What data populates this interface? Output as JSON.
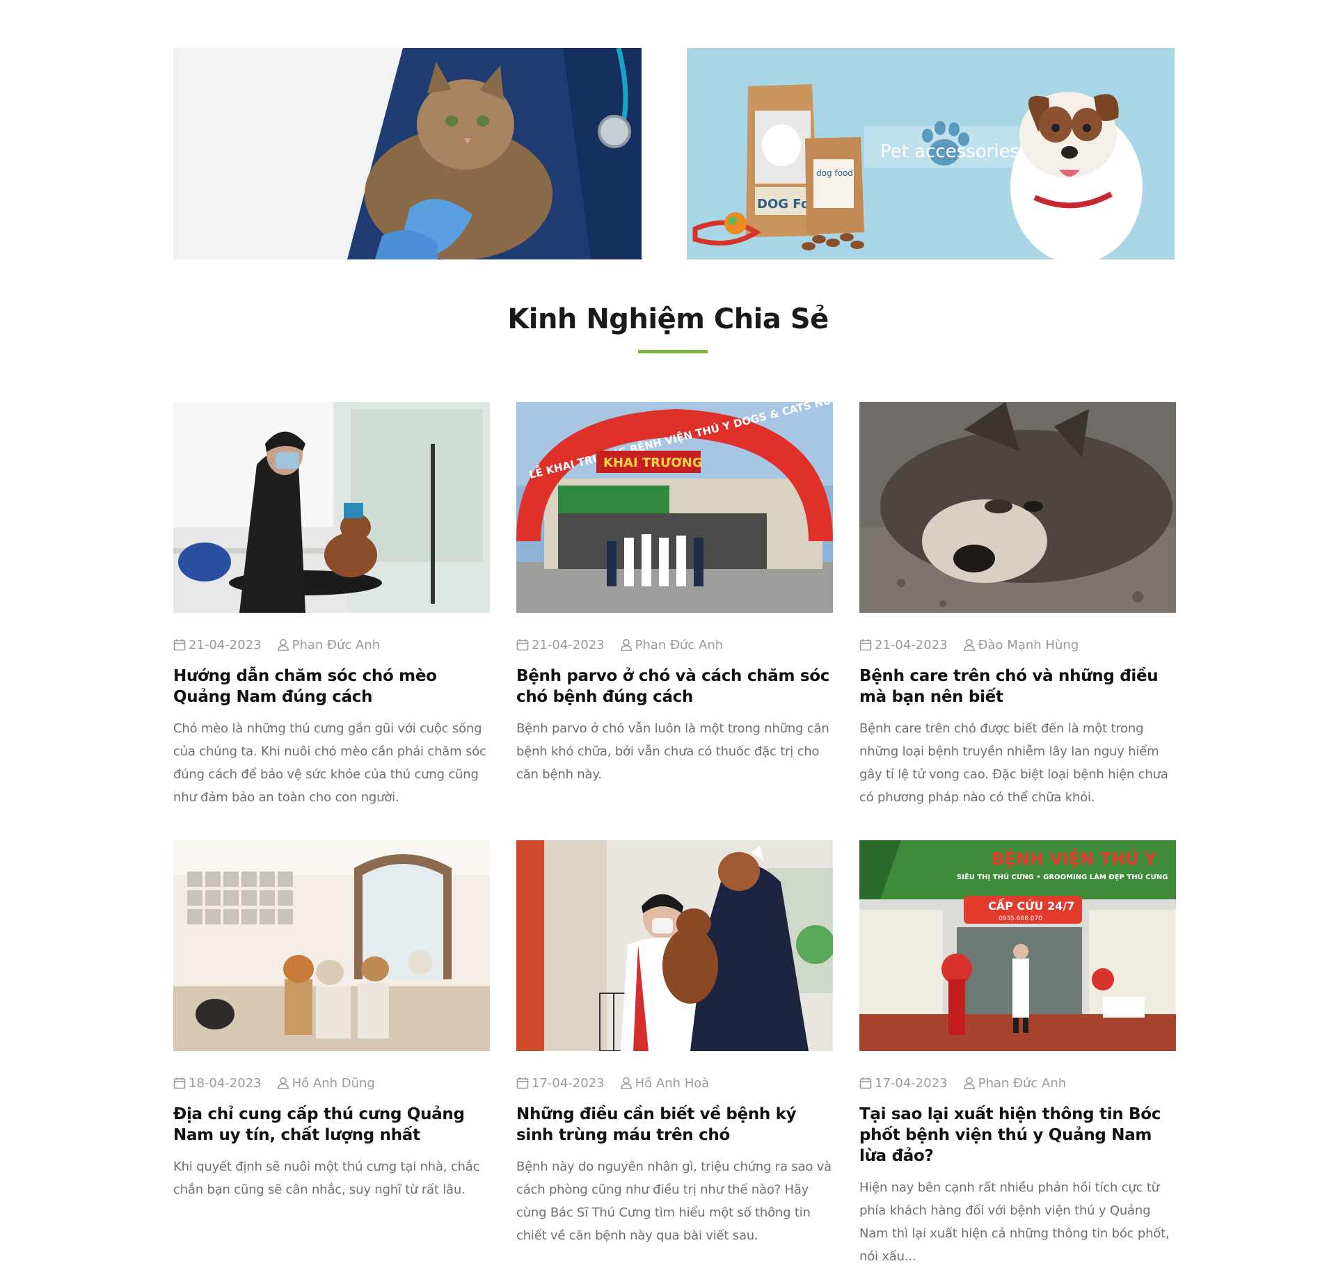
{
  "banners": {
    "accessories_text": "Pet accessories",
    "bag_label": "DOG Food",
    "bag2_label": "dog food"
  },
  "section": {
    "title": "Kinh Nghiệm Chia Sẻ",
    "accent_color": "#7cb342"
  },
  "posts": [
    {
      "date": "21-04-2023",
      "author": "Phan Đức Anh",
      "title": "Hướng dẫn chăm sóc chó mèo Quảng Nam đúng cách",
      "excerpt": "Chó mèo là những thú cưng gần gũi với cuộc sống của chúng ta. Khi nuôi chó mèo cần phải chăm sóc đúng cách để bảo vệ sức khỏe của thú cưng cũng như đảm bảo an toàn cho con người."
    },
    {
      "date": "21-04-2023",
      "author": "Phan Đức Anh",
      "title": "Bệnh parvo ở chó và cách chăm sóc chó bệnh đúng cách",
      "excerpt": "Bệnh parvo ở chó vẫn luôn là một trong những căn bệnh khó chữa, bởi vẫn chưa có thuốc đặc trị cho căn bệnh này."
    },
    {
      "date": "21-04-2023",
      "author": "Đào Mạnh Hùng",
      "title": "Bệnh care trên chó và những điều mà bạn nên biết",
      "excerpt": "Bệnh care trên chó được biết đến là một trong những loại bệnh truyền nhiễm lây lan nguy hiểm gây tỉ lệ tử vong cao. Đặc biệt loại bệnh hiện chưa có phương pháp nào có thể chữa khỏi."
    },
    {
      "date": "18-04-2023",
      "author": "Hồ Anh Dũng",
      "title": "Địa chỉ cung cấp thú cưng Quảng Nam uy tín, chất lượng nhất",
      "excerpt": "Khi quyết định sẽ nuôi một thú cưng tại nhà, chắc chắn bạn cũng sẽ cân nhắc, suy nghĩ từ rất lâu."
    },
    {
      "date": "17-04-2023",
      "author": "Hồ Anh Hoà",
      "title": "Những điều cần biết về bệnh ký sinh trùng máu trên chó",
      "excerpt": "Bệnh này do nguyên nhân gì, triệu chứng ra sao và cách phòng cũng như điều trị như thế nào? Hãy cùng Bác Sĩ Thú Cưng tìm hiểu một số thông tin chiết về căn bệnh này qua bài viết sau."
    },
    {
      "date": "17-04-2023",
      "author": "Phan Đức Anh",
      "title": "Tại sao lại xuất hiện thông tin Bóc phốt bệnh viện thú y Quảng Nam lừa đảo?",
      "excerpt": "Hiện nay bên cạnh rất nhiều phản hồi tích cực từ phía khách hàng đối với bệnh viện thú y Quảng Nam thì lại xuất hiện cả những thông tin bóc phốt, nói xấu..."
    }
  ],
  "photo_signs": {
    "arch_text": "LỄ KHAI TRƯƠNG BỆNH VIỆN THÚ Y DOGS & CATS NÚI THÀNH",
    "arch_banner": "KHAI TRƯƠNG",
    "clinic_sign": "BỆNH VIỆN THÚ Y",
    "clinic_sub": "SIÊU THỊ THÚ CƯNG • GROOMING LÀM ĐẸP THÚ CƯNG",
    "emergency": "CẤP CỨU 24/7",
    "phone": "0935.668.070"
  },
  "icons": {
    "date": "calendar-icon",
    "author": "user-icon"
  }
}
